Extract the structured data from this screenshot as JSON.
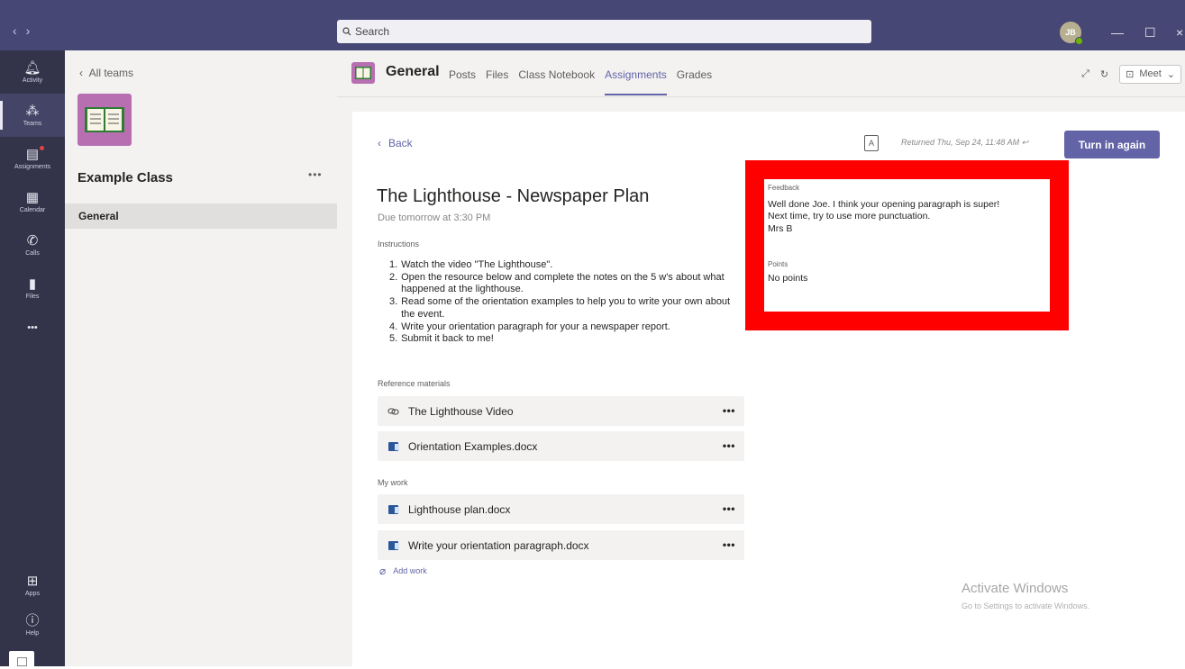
{
  "titlebar": {
    "search_placeholder": "Search",
    "avatar_initials": "JB"
  },
  "rail": {
    "items": [
      {
        "label": "Activity",
        "icon": "bell-icon"
      },
      {
        "label": "Teams",
        "icon": "teams-icon"
      },
      {
        "label": "Assignments",
        "icon": "assignments-icon"
      },
      {
        "label": "Calendar",
        "icon": "calendar-icon"
      },
      {
        "label": "Calls",
        "icon": "phone-icon"
      },
      {
        "label": "Files",
        "icon": "file-icon"
      }
    ],
    "more": "•••",
    "apps_label": "Apps",
    "help_label": "Help"
  },
  "sidebar": {
    "back_label": "All teams",
    "team_name": "Example Class",
    "team_more": "•••",
    "channel": "General"
  },
  "header": {
    "channel_title": "General",
    "tabs": [
      "Posts",
      "Files",
      "Class Notebook",
      "Assignments",
      "Grades"
    ],
    "active_tab": "Assignments",
    "meet_label": "Meet"
  },
  "assignment": {
    "back_label": "Back",
    "returned_text": "Returned Thu, Sep 24, 11:48 AM",
    "turn_in_label": "Turn in again",
    "title": "The Lighthouse - Newspaper Plan",
    "due": "Due tomorrow at 3:30 PM",
    "instructions_label": "Instructions",
    "instructions": [
      {
        "num": "1.",
        "text": "Watch the video \"The Lighthouse\"."
      },
      {
        "num": "2.",
        "text": "Open the resource below and complete the notes on the 5 w's about what happened at the lighthouse."
      },
      {
        "num": "3.",
        "text": "Read some of the orientation examples to help you to write your own about the event."
      },
      {
        "num": "4.",
        "text": " Write your orientation paragraph for your a newspaper report."
      },
      {
        "num": "5.",
        "text": "Submit it back to me!"
      }
    ],
    "reference_label": "Reference materials",
    "reference": [
      {
        "name": "The Lighthouse Video",
        "icon": "link-icon"
      },
      {
        "name": "Orientation Examples.docx",
        "icon": "word-doc-icon"
      }
    ],
    "my_work_label": "My work",
    "my_work": [
      {
        "name": "Lighthouse plan.docx",
        "icon": "word-doc-icon"
      },
      {
        "name": "Write your orientation paragraph.docx",
        "icon": "word-doc-icon"
      }
    ],
    "add_work_label": "Add work",
    "row_more": "•••"
  },
  "feedback": {
    "label": "Feedback",
    "lines": [
      "Well done Joe. I think your opening paragraph is super!",
      "Next time, try to use more punctuation.",
      "Mrs B"
    ],
    "points_label": "Points",
    "points_value": "No points",
    "highlight_color": "#ff0000"
  },
  "watermark": {
    "title": "Activate Windows",
    "subtitle": "Go to Settings to activate Windows."
  },
  "colors": {
    "titlebar": "#464775",
    "rail": "#33344a",
    "accent": "#6264a7",
    "team_tile": "#b86fb2"
  }
}
